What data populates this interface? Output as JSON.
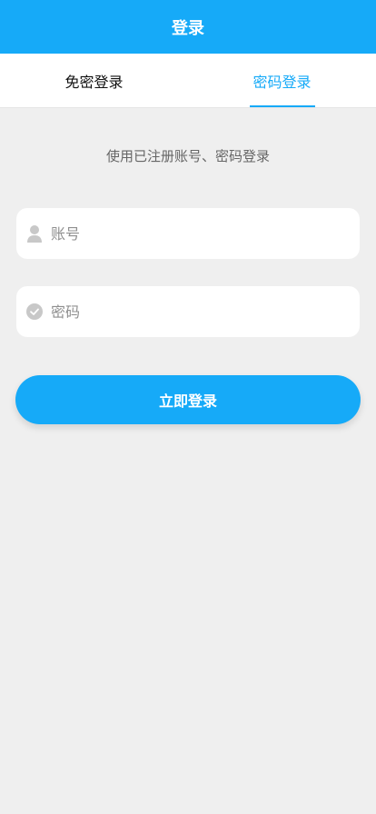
{
  "header": {
    "title": "登录"
  },
  "tabs": [
    {
      "label": "免密登录",
      "active": false
    },
    {
      "label": "密码登录",
      "active": true
    }
  ],
  "hint": "使用已注册账号、密码登录",
  "form": {
    "account": {
      "placeholder": "账号",
      "value": "",
      "icon": "user-icon"
    },
    "password": {
      "placeholder": "密码",
      "value": "",
      "icon": "check-circle-icon"
    },
    "submit_label": "立即登录"
  },
  "colors": {
    "accent": "#16aaf8",
    "background": "#efefef",
    "icon": "#c8c8c8"
  }
}
